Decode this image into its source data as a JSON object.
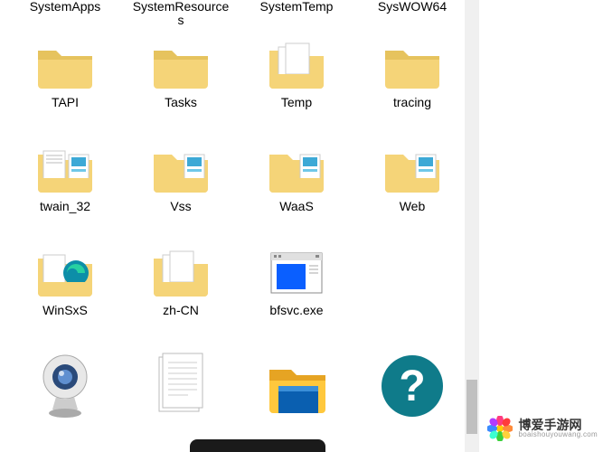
{
  "items": [
    {
      "name": "SystemApps",
      "type": "folder-label-only"
    },
    {
      "name": "SystemResources",
      "type": "folder-label-only"
    },
    {
      "name": "SystemTemp",
      "type": "folder-label-only"
    },
    {
      "name": "SysWOW64",
      "type": "folder-label-only"
    },
    {
      "name": "TAPI",
      "type": "folder"
    },
    {
      "name": "Tasks",
      "type": "folder"
    },
    {
      "name": "Temp",
      "type": "folder-docs"
    },
    {
      "name": "tracing",
      "type": "folder"
    },
    {
      "name": "twain_32",
      "type": "folder-preview"
    },
    {
      "name": "Vss",
      "type": "folder-preview"
    },
    {
      "name": "WaaS",
      "type": "folder-preview"
    },
    {
      "name": "Web",
      "type": "folder-preview"
    },
    {
      "name": "WinSxS",
      "type": "folder-edge"
    },
    {
      "name": "zh-CN",
      "type": "folder-docs"
    },
    {
      "name": "bfsvc.exe",
      "type": "app-window"
    },
    {
      "name": "",
      "type": "empty"
    },
    {
      "name": "",
      "type": "camera"
    },
    {
      "name": "",
      "type": "text-doc"
    },
    {
      "name": "",
      "type": "explorer-app"
    },
    {
      "name": "",
      "type": "help"
    }
  ],
  "watermark": {
    "title": "博爱手游网",
    "url": "boaishouyouwang.com"
  },
  "colors": {
    "folder": "#f5d478",
    "folder_shadow": "#e6c35e",
    "help_blue": "#0f7b8a",
    "explorer_blue": "#0a5fb0",
    "explorer_accent": "#ffc83d"
  }
}
